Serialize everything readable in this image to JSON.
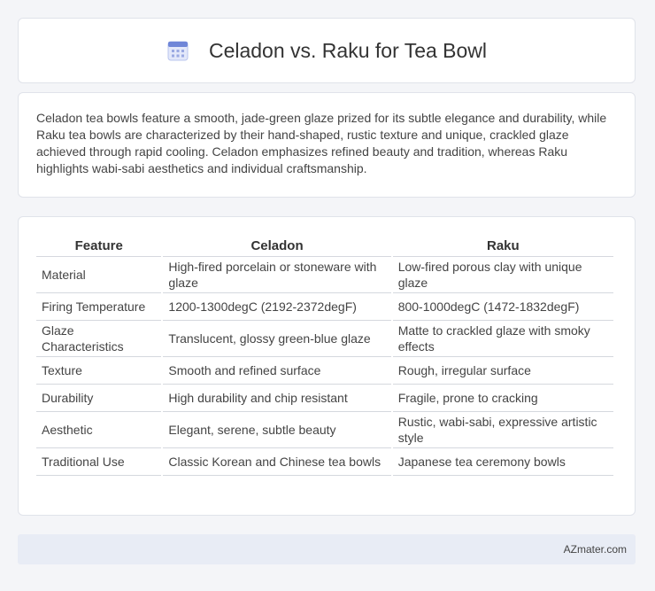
{
  "header": {
    "title": "Celadon vs. Raku for Tea Bowl",
    "icon": "calendar-grid-icon",
    "accent": "#7a8fd6"
  },
  "summary": {
    "text": "Celadon tea bowls feature a smooth, jade-green glaze prized for its subtle elegance and durability, while Raku tea bowls are characterized by their hand-shaped, rustic texture and unique, crackled glaze achieved through rapid cooling. Celadon emphasizes refined beauty and tradition, whereas Raku highlights wabi-sabi aesthetics and individual craftsmanship."
  },
  "table": {
    "headers": [
      "Feature",
      "Celadon",
      "Raku"
    ],
    "rows": [
      [
        "Material",
        "High-fired porcelain or stoneware with glaze",
        "Low-fired porous clay with unique glaze"
      ],
      [
        "Firing Temperature",
        "1200-1300degC (2192-2372degF)",
        "800-1000degC (1472-1832degF)"
      ],
      [
        "Glaze Characteristics",
        "Translucent, glossy green-blue glaze",
        "Matte to crackled glaze with smoky effects"
      ],
      [
        "Texture",
        "Smooth and refined surface",
        "Rough, irregular surface"
      ],
      [
        "Durability",
        "High durability and chip resistant",
        "Fragile, prone to cracking"
      ],
      [
        "Aesthetic",
        "Elegant, serene, subtle beauty",
        "Rustic, wabi-sabi, expressive artistic style"
      ],
      [
        "Traditional Use",
        "Classic Korean and Chinese tea bowls",
        "Japanese tea ceremony bowls"
      ]
    ]
  },
  "footer": {
    "text": "AZmater.com"
  }
}
